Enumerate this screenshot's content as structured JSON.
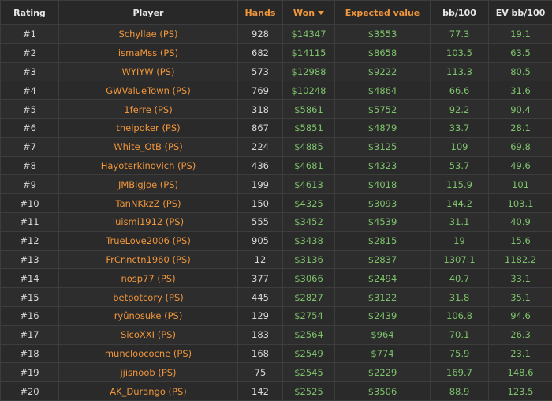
{
  "header": {
    "rating": "Rating",
    "player": "Player",
    "hands": "Hands",
    "won": "Won",
    "expected_value": "Expected value",
    "bb100": "bb/100",
    "ev_bb100": "EV bb/100"
  },
  "colors": {
    "accent_orange": "#f0963c",
    "value_green": "#7dc36b",
    "background": "#2b2b2b"
  },
  "rows": [
    {
      "rank": "#1",
      "player": "Schyllae (PS)",
      "hands": "928",
      "won": "$14347",
      "ev": "$3553",
      "bb100": "77.3",
      "evbb100": "19.1"
    },
    {
      "rank": "#2",
      "player": "ismaMss (PS)",
      "hands": "682",
      "won": "$14115",
      "ev": "$8658",
      "bb100": "103.5",
      "evbb100": "63.5"
    },
    {
      "rank": "#3",
      "player": "WYIYW (PS)",
      "hands": "573",
      "won": "$12988",
      "ev": "$9222",
      "bb100": "113.3",
      "evbb100": "80.5"
    },
    {
      "rank": "#4",
      "player": "GWValueTown (PS)",
      "hands": "769",
      "won": "$10248",
      "ev": "$4864",
      "bb100": "66.6",
      "evbb100": "31.6"
    },
    {
      "rank": "#5",
      "player": "1ferre (PS)",
      "hands": "318",
      "won": "$5861",
      "ev": "$5752",
      "bb100": "92.2",
      "evbb100": "90.4"
    },
    {
      "rank": "#6",
      "player": "thelpoker (PS)",
      "hands": "867",
      "won": "$5851",
      "ev": "$4879",
      "bb100": "33.7",
      "evbb100": "28.1"
    },
    {
      "rank": "#7",
      "player": "White_OtB (PS)",
      "hands": "224",
      "won": "$4885",
      "ev": "$3125",
      "bb100": "109",
      "evbb100": "69.8"
    },
    {
      "rank": "#8",
      "player": "Hayoterkinovich (PS)",
      "hands": "436",
      "won": "$4681",
      "ev": "$4323",
      "bb100": "53.7",
      "evbb100": "49.6"
    },
    {
      "rank": "#9",
      "player": "JMBigJoe (PS)",
      "hands": "199",
      "won": "$4613",
      "ev": "$4018",
      "bb100": "115.9",
      "evbb100": "101"
    },
    {
      "rank": "#10",
      "player": "TanNKkzZ (PS)",
      "hands": "150",
      "won": "$4325",
      "ev": "$3093",
      "bb100": "144.2",
      "evbb100": "103.1"
    },
    {
      "rank": "#11",
      "player": "luismi1912 (PS)",
      "hands": "555",
      "won": "$3452",
      "ev": "$4539",
      "bb100": "31.1",
      "evbb100": "40.9"
    },
    {
      "rank": "#12",
      "player": "TrueLove2006 (PS)",
      "hands": "905",
      "won": "$3438",
      "ev": "$2815",
      "bb100": "19",
      "evbb100": "15.6"
    },
    {
      "rank": "#13",
      "player": "FrCnnctn1960 (PS)",
      "hands": "12",
      "won": "$3136",
      "ev": "$2837",
      "bb100": "1307.1",
      "evbb100": "1182.2"
    },
    {
      "rank": "#14",
      "player": "nosp77 (PS)",
      "hands": "377",
      "won": "$3066",
      "ev": "$2494",
      "bb100": "40.7",
      "evbb100": "33.1"
    },
    {
      "rank": "#15",
      "player": "betpotcory (PS)",
      "hands": "445",
      "won": "$2827",
      "ev": "$3122",
      "bb100": "31.8",
      "evbb100": "35.1"
    },
    {
      "rank": "#16",
      "player": "ryûnosuke (PS)",
      "hands": "129",
      "won": "$2754",
      "ev": "$2439",
      "bb100": "106.8",
      "evbb100": "94.6"
    },
    {
      "rank": "#17",
      "player": "SicoXXI (PS)",
      "hands": "183",
      "won": "$2564",
      "ev": "$964",
      "bb100": "70.1",
      "evbb100": "26.3"
    },
    {
      "rank": "#18",
      "player": "muncloococne (PS)",
      "hands": "168",
      "won": "$2549",
      "ev": "$774",
      "bb100": "75.9",
      "evbb100": "23.1"
    },
    {
      "rank": "#19",
      "player": "jjisnoob (PS)",
      "hands": "75",
      "won": "$2545",
      "ev": "$2229",
      "bb100": "169.7",
      "evbb100": "148.6"
    },
    {
      "rank": "#20",
      "player": "AK_Durango (PS)",
      "hands": "142",
      "won": "$2525",
      "ev": "$3506",
      "bb100": "88.9",
      "evbb100": "123.5"
    }
  ]
}
